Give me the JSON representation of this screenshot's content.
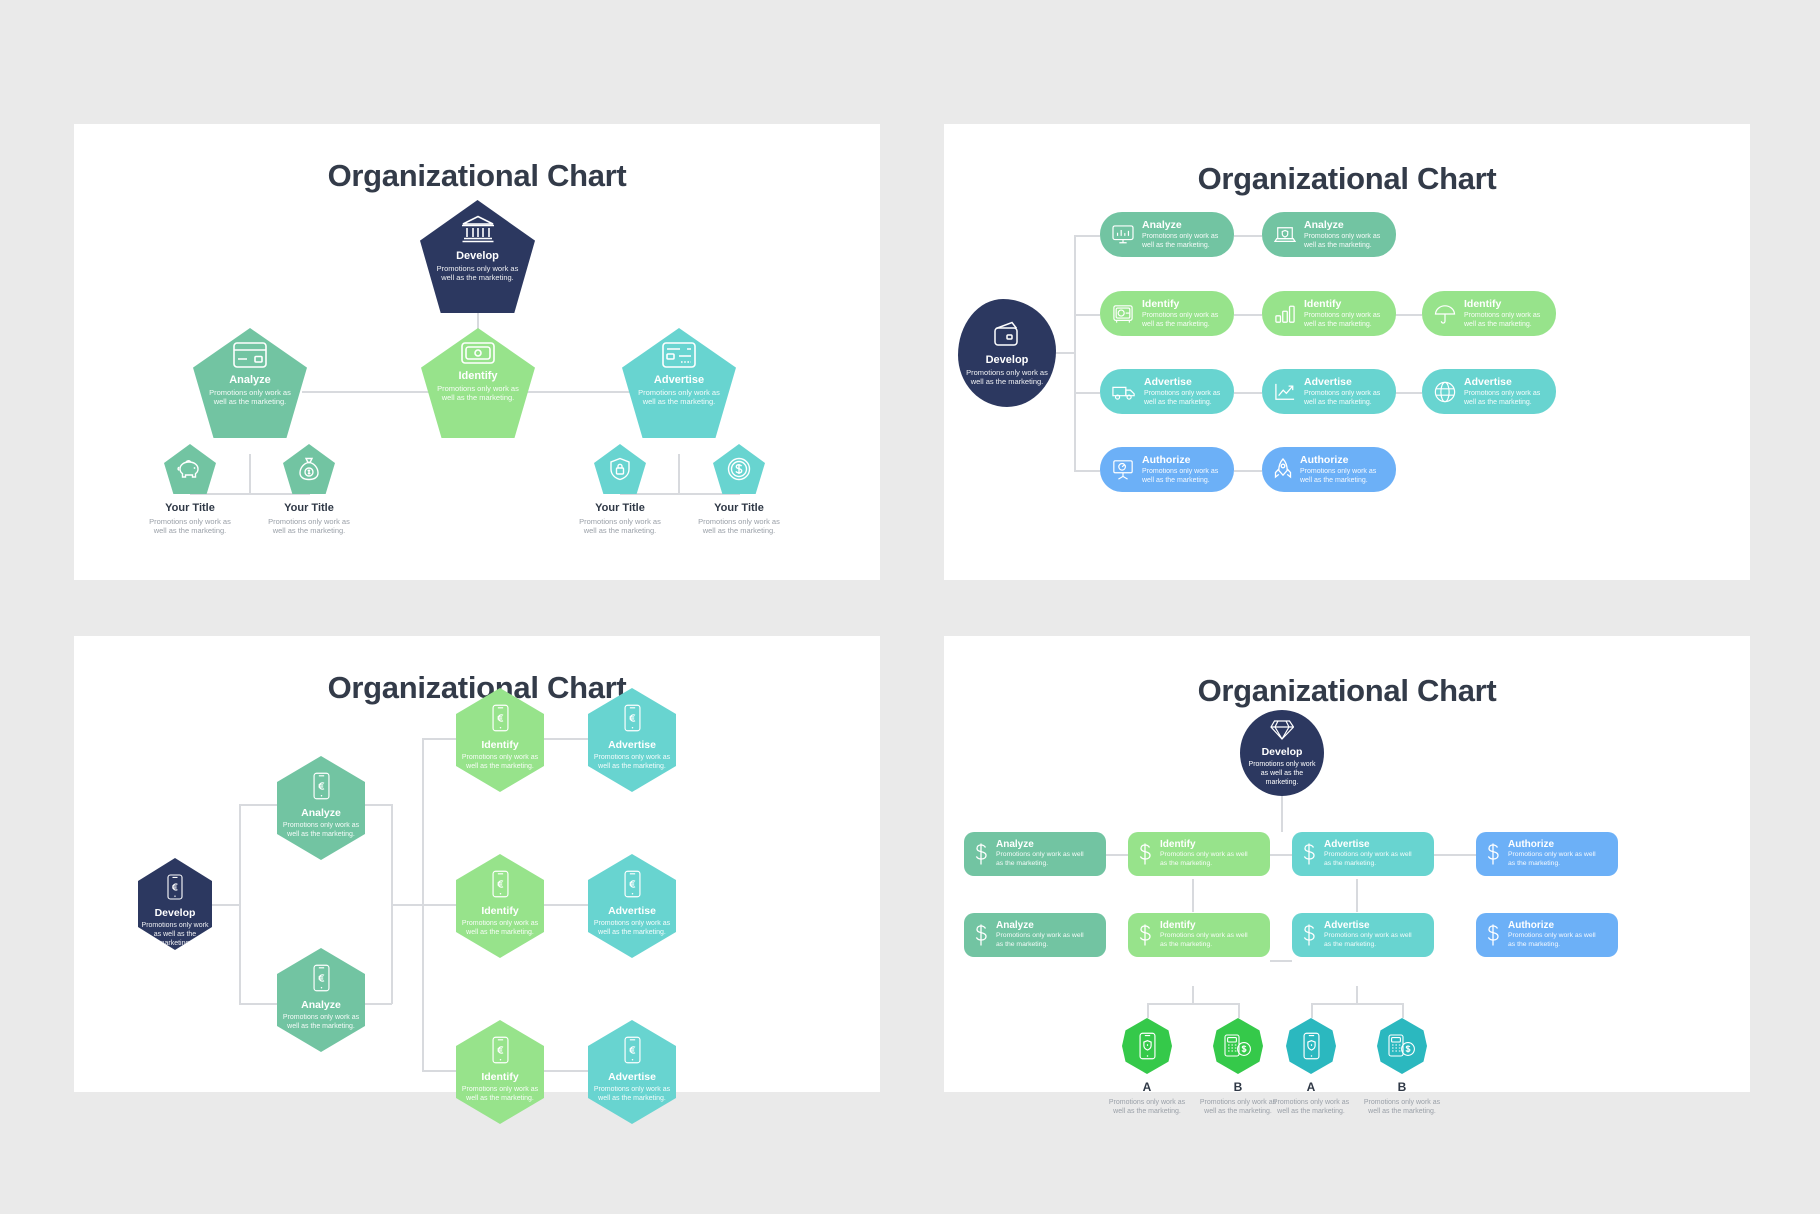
{
  "common": {
    "description": "Promotions only work as well as the marketing.",
    "description_alt": "Promotions only work as well as the marketing.",
    "title": "Organizational Chart"
  },
  "colors": {
    "background": "#eaeaea",
    "slide": "#ffffff",
    "title": "#333b49",
    "navy": "#2c3860",
    "green_sea": "#72c4a2",
    "green_light": "#97e38b",
    "teal": "#68d4d0",
    "blue": "#6cb0f7",
    "green_bright": "#35c94a",
    "teal_bright": "#2bb8bf",
    "connector": "#d8dade",
    "caption_title": "#2f3846",
    "caption_sub": "#9aa0a8"
  },
  "slides": [
    {
      "id": "slide-1",
      "title": "Organizational Chart",
      "type": "pentagon-tree",
      "root": {
        "label": "Develop",
        "desc": "Promotions only work as well as the marketing.",
        "icon": "bank-icon",
        "color": "#2c3860"
      },
      "branches": [
        {
          "label": "Analyze",
          "desc": "Promotions only work as well as the marketing.",
          "icon": "credit-card-icon",
          "color": "#72c4a2"
        },
        {
          "label": "Identify",
          "desc": "Promotions only work as well as the marketing.",
          "icon": "banknote-icon",
          "color": "#97e38b"
        },
        {
          "label": "Advertise",
          "desc": "Promotions only work as well as the marketing.",
          "icon": "cheque-icon",
          "color": "#68d4d0"
        }
      ],
      "leaves": [
        {
          "label": "Your Title",
          "desc": "Promotions only work as well as the marketing.",
          "icon": "piggy-bank-icon",
          "color": "#72c4a2"
        },
        {
          "label": "Your Title",
          "desc": "Promotions only work as well as the marketing.",
          "icon": "money-bag-icon",
          "color": "#72c4a2"
        },
        {
          "label": "Your Title",
          "desc": "Promotions only work as well as the marketing.",
          "icon": "shield-lock-icon",
          "color": "#68d4d0"
        },
        {
          "label": "Your Title",
          "desc": "Promotions only work as well as the marketing.",
          "icon": "dollar-coin-icon",
          "color": "#68d4d0"
        }
      ]
    },
    {
      "id": "slide-2",
      "title": "Organizational Chart",
      "type": "pill-tree",
      "root": {
        "label": "Develop",
        "desc": "Promotions only work as well as the marketing.",
        "icon": "wallet-icon",
        "color": "#2c3860"
      },
      "rows": [
        {
          "color": "#72c4a2",
          "items": [
            {
              "label": "Analyze",
              "desc": "Promotions only work as well as the marketing.",
              "icon": "monitor-chart-icon"
            },
            {
              "label": "Analyze",
              "desc": "Promotions only work as well as the marketing.",
              "icon": "laptop-shield-icon"
            }
          ]
        },
        {
          "color": "#97e38b",
          "items": [
            {
              "label": "Identify",
              "desc": "Promotions only work as well as the marketing.",
              "icon": "safe-icon"
            },
            {
              "label": "Identify",
              "desc": "Promotions only work as well as the marketing.",
              "icon": "bar-chart-icon"
            },
            {
              "label": "Identify",
              "desc": "Promotions only work as well as the marketing.",
              "icon": "umbrella-icon"
            }
          ]
        },
        {
          "color": "#68d4d0",
          "items": [
            {
              "label": "Advertise",
              "desc": "Promotions only work as well as the marketing.",
              "icon": "delivery-van-icon"
            },
            {
              "label": "Advertise",
              "desc": "Promotions only work as well as the marketing.",
              "icon": "growth-chart-icon"
            },
            {
              "label": "Advertise",
              "desc": "Promotions only work as well as the marketing.",
              "icon": "globe-icon"
            }
          ]
        },
        {
          "color": "#6cb0f7",
          "items": [
            {
              "label": "Authorize",
              "desc": "Promotions only work as well as the marketing.",
              "icon": "presentation-icon"
            },
            {
              "label": "Authorize",
              "desc": "Promotions only work as well as the marketing.",
              "icon": "rocket-icon"
            }
          ]
        }
      ]
    },
    {
      "id": "slide-3",
      "title": "Organizational Chart",
      "type": "hexagon-tree",
      "root": {
        "label": "Develop",
        "desc": "Promotions only work as well as the marketing.",
        "icon": "mobile-euro-icon",
        "color": "#2c3860"
      },
      "level1": [
        {
          "label": "Analyze",
          "desc": "Promotions only work as well as the marketing.",
          "icon": "mobile-euro-icon",
          "color": "#72c4a2"
        },
        {
          "label": "Analyze",
          "desc": "Promotions only work as well as the marketing.",
          "icon": "mobile-euro-icon",
          "color": "#72c4a2"
        }
      ],
      "level2": [
        {
          "label": "Identify",
          "desc": "Promotions only work as well as the marketing.",
          "icon": "mobile-euro-icon",
          "color": "#97e38b"
        },
        {
          "label": "Identify",
          "desc": "Promotions only work as well as the marketing.",
          "icon": "mobile-euro-icon",
          "color": "#97e38b"
        },
        {
          "label": "Identify",
          "desc": "Promotions only work as well as the marketing.",
          "icon": "mobile-euro-icon",
          "color": "#97e38b"
        }
      ],
      "level3": [
        {
          "label": "Advertise",
          "desc": "Promotions only work as well as the marketing.",
          "icon": "mobile-euro-icon",
          "color": "#68d4d0"
        },
        {
          "label": "Advertise",
          "desc": "Promotions only work as well as the marketing.",
          "icon": "mobile-euro-icon",
          "color": "#68d4d0"
        },
        {
          "label": "Advertise",
          "desc": "Promotions only work as well as the marketing.",
          "icon": "mobile-euro-icon",
          "color": "#68d4d0"
        }
      ]
    },
    {
      "id": "slide-4",
      "title": "Organizational Chart",
      "type": "card-tree",
      "root": {
        "label": "Develop",
        "desc": "Promotions only work as well as the marketing.",
        "icon": "diamond-icon",
        "color": "#2c3860"
      },
      "rowA": [
        {
          "label": "Analyze",
          "desc": "Promotions only work as well as the marketing.",
          "icon": "dollar-icon",
          "color": "#72c4a2"
        },
        {
          "label": "Identify",
          "desc": "Promotions only work as well as the marketing.",
          "icon": "dollar-icon",
          "color": "#97e38b"
        },
        {
          "label": "Advertise",
          "desc": "Promotions only work as well as the marketing.",
          "icon": "dollar-icon",
          "color": "#68d4d0"
        },
        {
          "label": "Authorize",
          "desc": "Promotions only work as well as the marketing.",
          "icon": "dollar-icon",
          "color": "#6cb0f7"
        }
      ],
      "rowB": [
        {
          "label": "Analyze",
          "desc": "Promotions only work as well as the marketing.",
          "icon": "dollar-icon",
          "color": "#72c4a2"
        },
        {
          "label": "Identify",
          "desc": "Promotions only work as well as the marketing.",
          "icon": "dollar-icon",
          "color": "#97e38b"
        },
        {
          "label": "Advertise",
          "desc": "Promotions only work as well as the marketing.",
          "icon": "dollar-icon",
          "color": "#68d4d0"
        },
        {
          "label": "Authorize",
          "desc": "Promotions only work as well as the marketing.",
          "icon": "dollar-icon",
          "color": "#6cb0f7"
        }
      ],
      "leaves": [
        {
          "label": "A",
          "desc": "Promotions only work as well as the marketing.",
          "icon": "phone-shield-icon",
          "color": "#35c94a"
        },
        {
          "label": "B",
          "desc": "Promotions only work as well as the marketing.",
          "icon": "pos-terminal-icon",
          "color": "#35c94a"
        },
        {
          "label": "A",
          "desc": "Promotions only work as well as the marketing.",
          "icon": "phone-shield-icon",
          "color": "#2bb8bf"
        },
        {
          "label": "B",
          "desc": "Promotions only work as well as the marketing.",
          "icon": "pos-terminal-icon",
          "color": "#2bb8bf"
        }
      ]
    }
  ]
}
